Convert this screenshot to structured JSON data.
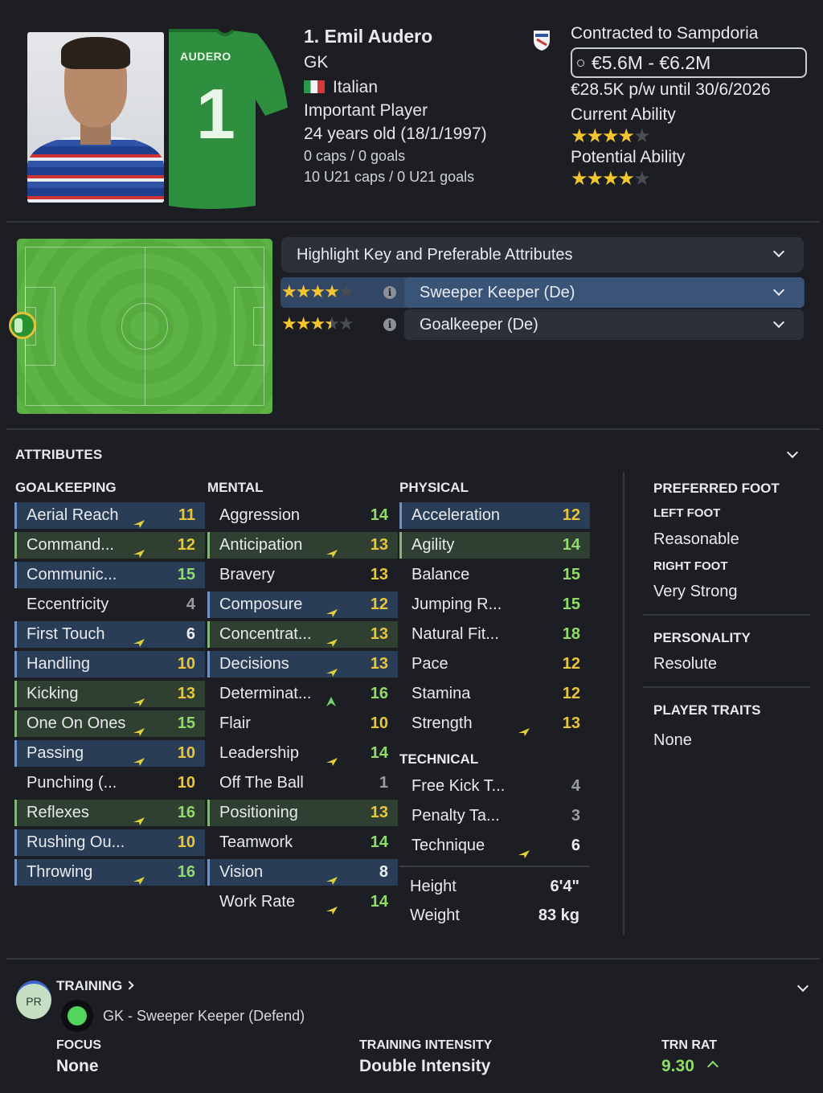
{
  "player": {
    "name": "1. Emil Audero",
    "position": "GK",
    "nationality": "Italian",
    "squad_status": "Important Player",
    "age": "24 years old (18/1/1997)",
    "caps": "0 caps / 0 goals",
    "u21_caps": "10 U21 caps / 0 U21 goals",
    "jersey_name": "AUDERO",
    "jersey_number": "1"
  },
  "contract": {
    "club_line": "Contracted to Sampdoria",
    "value_range": "€5.6M - €6.2M",
    "wage": "€28.5K p/w until 30/6/2026",
    "current_ability_label": "Current Ability",
    "current_ability_stars": 4,
    "potential_ability_label": "Potential Ability",
    "potential_ability_stars": 4
  },
  "roles": {
    "highlight_label": "Highlight Key and Preferable Attributes",
    "items": [
      {
        "name": "Sweeper Keeper (De)",
        "stars": 4,
        "selected": true
      },
      {
        "name": "Goalkeeper (De)",
        "stars": 3.5,
        "selected": false
      }
    ]
  },
  "attributes": {
    "section_title": "ATTRIBUTES",
    "goalkeeping": {
      "title": "GOALKEEPING",
      "items": [
        {
          "name": "Aerial Reach",
          "value": "11",
          "hl": "key",
          "arrow": "up-right",
          "color": "y"
        },
        {
          "name": "Command...",
          "value": "12",
          "hl": "pref",
          "arrow": "up-right",
          "color": "y"
        },
        {
          "name": "Communic...",
          "value": "15",
          "hl": "key",
          "arrow": "",
          "color": "g"
        },
        {
          "name": "Eccentricity",
          "value": "4",
          "hl": "",
          "arrow": "",
          "color": "gr"
        },
        {
          "name": "First Touch",
          "value": "6",
          "hl": "key",
          "arrow": "up-right",
          "color": "w"
        },
        {
          "name": "Handling",
          "value": "10",
          "hl": "key",
          "arrow": "",
          "color": "y"
        },
        {
          "name": "Kicking",
          "value": "13",
          "hl": "pref",
          "arrow": "up-right",
          "color": "y"
        },
        {
          "name": "One On Ones",
          "value": "15",
          "hl": "pref",
          "arrow": "up-right",
          "color": "g"
        },
        {
          "name": "Passing",
          "value": "10",
          "hl": "key",
          "arrow": "up-right",
          "color": "y"
        },
        {
          "name": "Punching (...",
          "value": "10",
          "hl": "",
          "arrow": "",
          "color": "y"
        },
        {
          "name": "Reflexes",
          "value": "16",
          "hl": "pref",
          "arrow": "up-right",
          "color": "g"
        },
        {
          "name": "Rushing Ou...",
          "value": "10",
          "hl": "key",
          "arrow": "",
          "color": "y"
        },
        {
          "name": "Throwing",
          "value": "16",
          "hl": "key",
          "arrow": "up-right",
          "color": "g"
        }
      ]
    },
    "mental": {
      "title": "MENTAL",
      "items": [
        {
          "name": "Aggression",
          "value": "14",
          "hl": "",
          "arrow": "",
          "color": "g"
        },
        {
          "name": "Anticipation",
          "value": "13",
          "hl": "pref",
          "arrow": "up-right",
          "color": "y"
        },
        {
          "name": "Bravery",
          "value": "13",
          "hl": "",
          "arrow": "",
          "color": "y"
        },
        {
          "name": "Composure",
          "value": "12",
          "hl": "key",
          "arrow": "up-right",
          "color": "y"
        },
        {
          "name": "Concentrat...",
          "value": "13",
          "hl": "pref",
          "arrow": "up-right",
          "color": "y"
        },
        {
          "name": "Decisions",
          "value": "13",
          "hl": "key",
          "arrow": "up-right",
          "color": "y"
        },
        {
          "name": "Determinat...",
          "value": "16",
          "hl": "",
          "arrow": "up",
          "color": "g"
        },
        {
          "name": "Flair",
          "value": "10",
          "hl": "",
          "arrow": "",
          "color": "y"
        },
        {
          "name": "Leadership",
          "value": "14",
          "hl": "",
          "arrow": "up-right",
          "color": "g"
        },
        {
          "name": "Off The Ball",
          "value": "1",
          "hl": "",
          "arrow": "",
          "color": "gr"
        },
        {
          "name": "Positioning",
          "value": "13",
          "hl": "pref",
          "arrow": "",
          "color": "y"
        },
        {
          "name": "Teamwork",
          "value": "14",
          "hl": "",
          "arrow": "",
          "color": "g"
        },
        {
          "name": "Vision",
          "value": "8",
          "hl": "key",
          "arrow": "up-right",
          "color": "w"
        },
        {
          "name": "Work Rate",
          "value": "14",
          "hl": "",
          "arrow": "up-right",
          "color": "g"
        }
      ]
    },
    "physical": {
      "title": "PHYSICAL",
      "items": [
        {
          "name": "Acceleration",
          "value": "12",
          "hl": "key",
          "arrow": "",
          "color": "y"
        },
        {
          "name": "Agility",
          "value": "14",
          "hl": "pref",
          "arrow": "",
          "color": "g"
        },
        {
          "name": "Balance",
          "value": "15",
          "hl": "",
          "arrow": "",
          "color": "g"
        },
        {
          "name": "Jumping R...",
          "value": "15",
          "hl": "",
          "arrow": "",
          "color": "g"
        },
        {
          "name": "Natural Fit...",
          "value": "18",
          "hl": "",
          "arrow": "",
          "color": "g"
        },
        {
          "name": "Pace",
          "value": "12",
          "hl": "",
          "arrow": "",
          "color": "y"
        },
        {
          "name": "Stamina",
          "value": "12",
          "hl": "",
          "arrow": "",
          "color": "y"
        },
        {
          "name": "Strength",
          "value": "13",
          "hl": "",
          "arrow": "up-right",
          "color": "y"
        }
      ]
    },
    "technical": {
      "title": "TECHNICAL",
      "items": [
        {
          "name": "Free Kick T...",
          "value": "4",
          "hl": "",
          "arrow": "",
          "color": "gr"
        },
        {
          "name": "Penalty Ta...",
          "value": "3",
          "hl": "",
          "arrow": "",
          "color": "gr"
        },
        {
          "name": "Technique",
          "value": "6",
          "hl": "",
          "arrow": "up-right",
          "color": "w"
        }
      ]
    },
    "height_label": "Height",
    "height_value": "6'4\"",
    "weight_label": "Weight",
    "weight_value": "83 kg"
  },
  "side": {
    "preferred_foot_title": "PREFERRED FOOT",
    "left_foot_label": "LEFT FOOT",
    "left_foot_value": "Reasonable",
    "right_foot_label": "RIGHT FOOT",
    "right_foot_value": "Very Strong",
    "personality_title": "PERSONALITY",
    "personality_value": "Resolute",
    "traits_title": "PLAYER TRAITS",
    "traits_value": "None"
  },
  "training": {
    "badge": "PR",
    "title": "TRAINING",
    "role": "GK - Sweeper Keeper (Defend)",
    "focus_label": "FOCUS",
    "focus_value": "None",
    "intensity_label": "TRAINING INTENSITY",
    "intensity_value": "Double Intensity",
    "rating_label": "TRN RAT",
    "rating_value": "9.30"
  },
  "colors": {
    "key_highlight": "#2a3d56",
    "preferable_highlight": "#2f3f32",
    "star": "#f2c531",
    "green_value": "#8fdc6a",
    "yellow_value": "#e8c53a"
  }
}
